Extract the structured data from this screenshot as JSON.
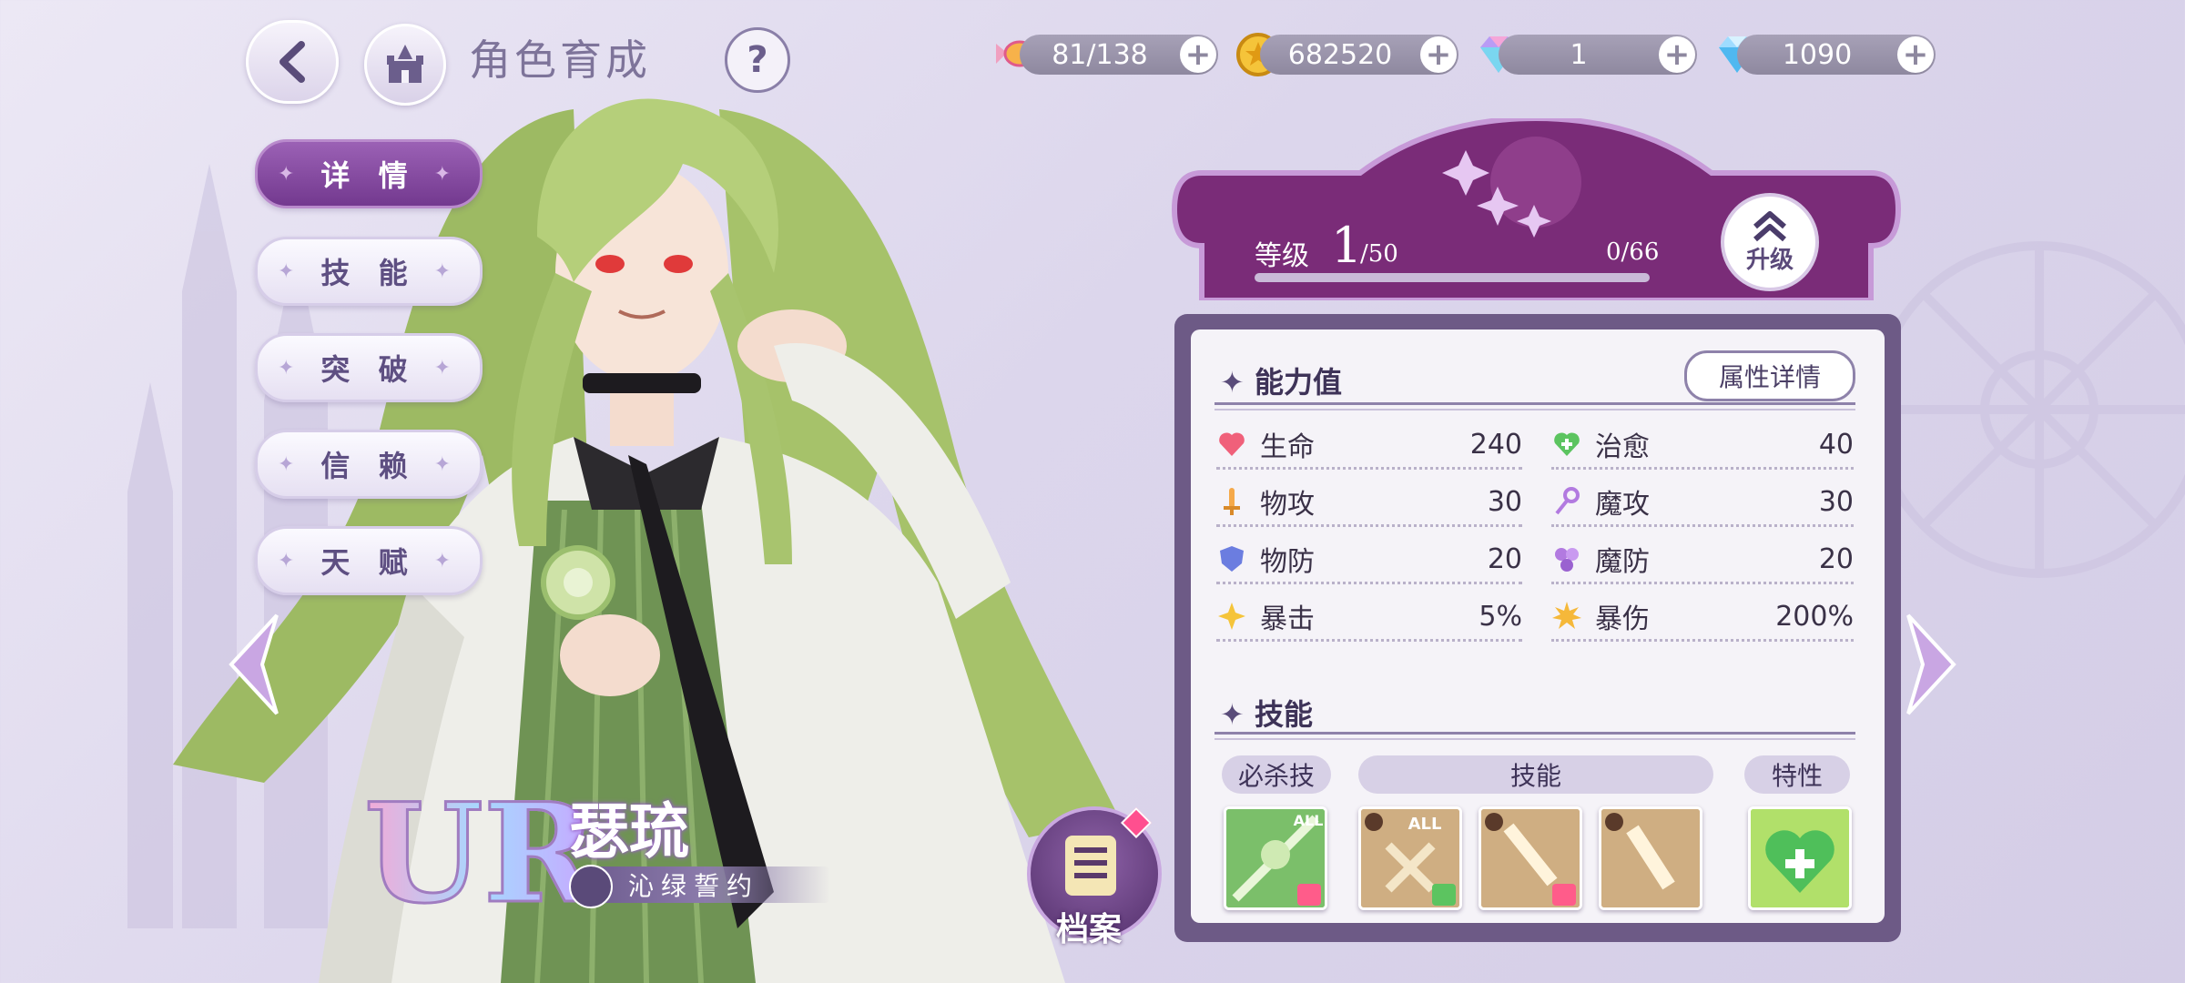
{
  "header": {
    "title": "角色育成",
    "help_label": "?"
  },
  "currencies": [
    {
      "name": "candy",
      "value": "81/138"
    },
    {
      "name": "gold-coin",
      "value": "682520"
    },
    {
      "name": "rainbow-gem",
      "value": "1"
    },
    {
      "name": "diamond",
      "value": "1090"
    }
  ],
  "tabs": [
    {
      "label": "详 情",
      "active": true
    },
    {
      "label": "技 能",
      "active": false
    },
    {
      "label": "突 破",
      "active": false
    },
    {
      "label": "信 赖",
      "active": false
    },
    {
      "label": "天 赋",
      "active": false
    }
  ],
  "character": {
    "rarity": "UR",
    "name": "瑟琉",
    "title": "沁绿誓约"
  },
  "archive": {
    "label": "档案"
  },
  "level": {
    "label": "等级",
    "value": "1",
    "max": "/50",
    "exp": "0/66",
    "exp_fraction": 0,
    "upgrade_label": "升级"
  },
  "stats": {
    "section_title": "能力值",
    "detail_button": "属性详情",
    "left": [
      {
        "icon": "heart-icon",
        "name": "生命",
        "value": "240"
      },
      {
        "icon": "sword-icon",
        "name": "物攻",
        "value": "30"
      },
      {
        "icon": "shield-icon",
        "name": "物防",
        "value": "20"
      },
      {
        "icon": "star-icon",
        "name": "暴击",
        "value": "5%"
      }
    ],
    "right": [
      {
        "icon": "heal-heart-icon",
        "name": "治愈",
        "value": "40"
      },
      {
        "icon": "wand-icon",
        "name": "魔攻",
        "value": "30"
      },
      {
        "icon": "orbs-icon",
        "name": "魔防",
        "value": "20"
      },
      {
        "icon": "burst-icon",
        "name": "暴伤",
        "value": "200%"
      }
    ]
  },
  "skills": {
    "section_title": "技能",
    "ultimate_label": "必杀技",
    "skills_label": "技能",
    "trait_label": "特性",
    "all_badge": "ALL",
    "colors": {
      "ultimate": "#7bbf6a",
      "skill": "#c9a679",
      "trait": "#a8dd5c"
    }
  }
}
